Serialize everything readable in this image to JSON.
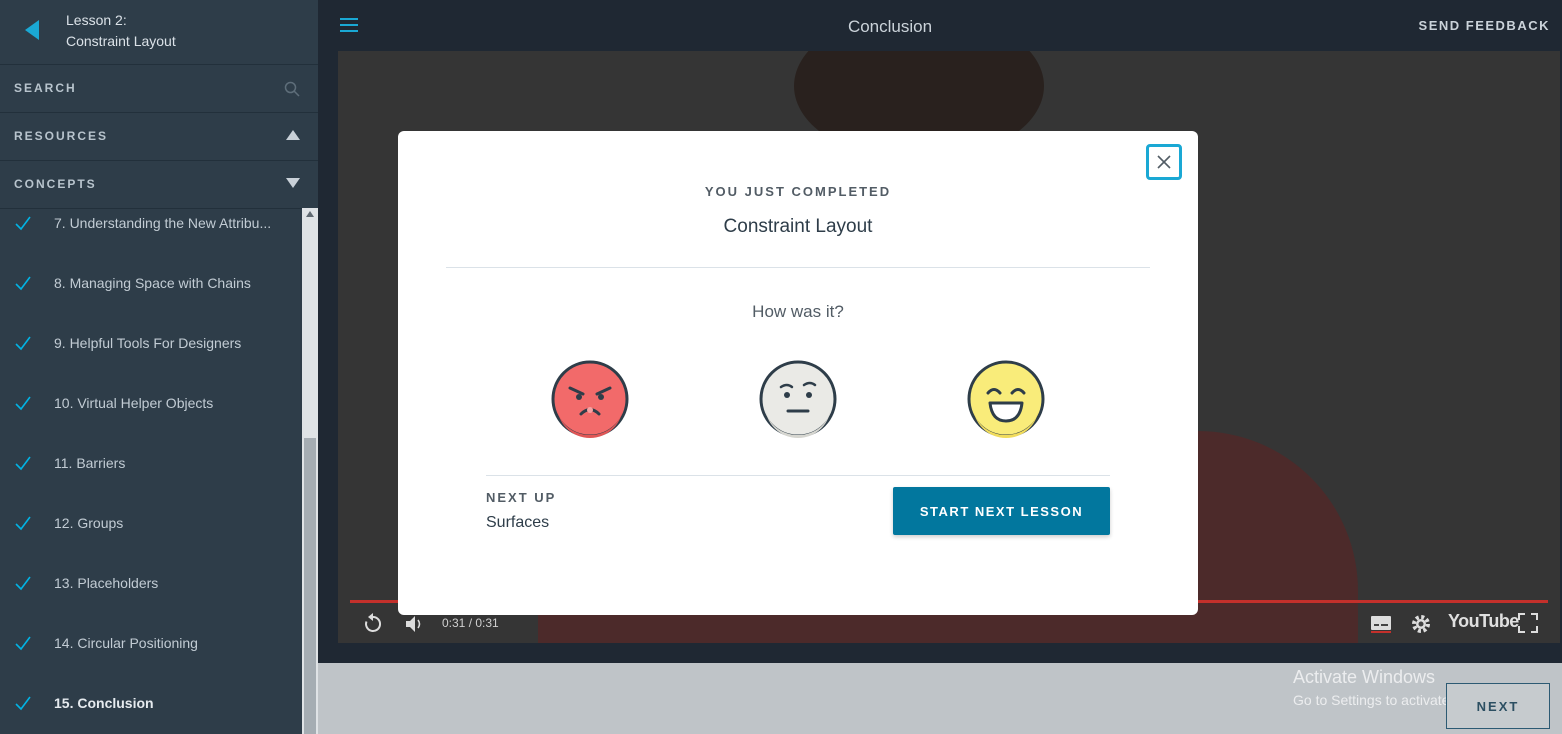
{
  "sidebar": {
    "lesson_number": "Lesson 2:",
    "lesson_name": "Constraint Layout",
    "search_label": "SEARCH",
    "resources_label": "RESOURCES",
    "concepts_label": "CONCEPTS",
    "concepts": [
      {
        "label": "7. Understanding the New Attribu...",
        "completed": true
      },
      {
        "label": "8. Managing Space with Chains",
        "completed": true
      },
      {
        "label": "9. Helpful Tools For Designers",
        "completed": true
      },
      {
        "label": "10. Virtual Helper Objects",
        "completed": true
      },
      {
        "label": "11. Barriers",
        "completed": true
      },
      {
        "label": "12. Groups",
        "completed": true
      },
      {
        "label": "13. Placeholders",
        "completed": true
      },
      {
        "label": "14. Circular Positioning",
        "completed": true
      },
      {
        "label": "15. Conclusion",
        "completed": true,
        "active": true
      }
    ]
  },
  "header": {
    "title": "Conclusion",
    "feedback_label": "SEND FEEDBACK"
  },
  "video": {
    "time": "0:31 / 0:31",
    "brand": "YouTube"
  },
  "modal": {
    "completed_label": "YOU JUST COMPLETED",
    "completed_name": "Constraint Layout",
    "question": "How was it?",
    "next_up_label": "NEXT UP",
    "next_up_name": "Surfaces",
    "start_button": "START NEXT LESSON"
  },
  "footer": {
    "next_label": "NEXT",
    "activate_title": "Activate Windows",
    "activate_sub": "Go to Settings to activate Windows."
  },
  "colors": {
    "accent": "#02779e",
    "check": "#02b3e4",
    "focus": "#1aa8d4"
  }
}
